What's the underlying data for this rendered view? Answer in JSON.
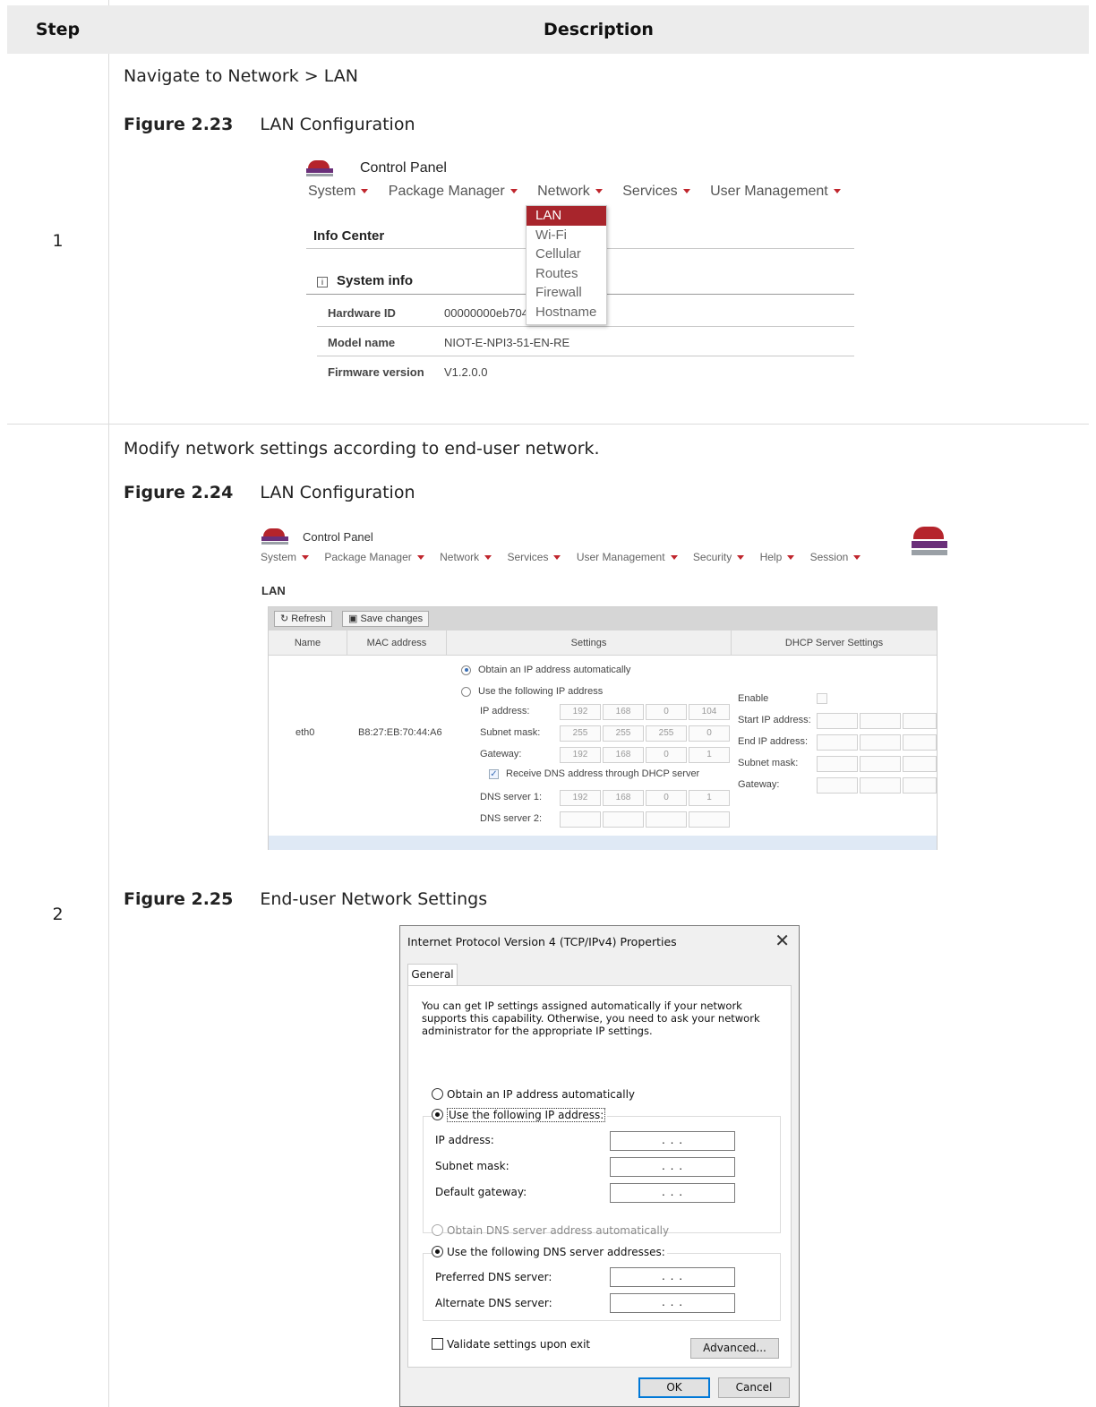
{
  "table": {
    "header_step": "Step",
    "header_description": "Description"
  },
  "step1": {
    "number": "1",
    "text": "Navigate to Network > LAN",
    "figure_number": "Figure 2.23",
    "figure_caption": "LAN Configuration",
    "screenshot": {
      "title": "Control Panel",
      "menu": [
        "System",
        "Package Manager",
        "Network",
        "Services",
        "User Management"
      ],
      "section_title": "Info Center",
      "panel_title": "System info",
      "rows": [
        {
          "key": "Hardware ID",
          "value": "00000000eb704"
        },
        {
          "key": "Model name",
          "value": "NIOT-E-NPI3-51-EN-RE"
        },
        {
          "key": "Firmware version",
          "value": "V1.2.0.0"
        }
      ],
      "network_dropdown": [
        "LAN",
        "Wi-Fi",
        "Cellular",
        "Routes",
        "Firewall",
        "Hostname"
      ]
    }
  },
  "step2": {
    "number": "2",
    "text": "Modify network settings according to end-user network.",
    "figure_a_number": "Figure 2.24",
    "figure_a_caption": "LAN Configuration",
    "figure_b_number": "Figure 2.25",
    "figure_b_caption": "End-user Network Settings",
    "lan_screenshot": {
      "title": "Control Panel",
      "menu": [
        "System",
        "Package Manager",
        "Network",
        "Services",
        "User Management",
        "Security",
        "Help",
        "Session"
      ],
      "page_title": "LAN",
      "toolbar": {
        "refresh": "Refresh",
        "save": "Save changes"
      },
      "columns": [
        "Name",
        "MAC address",
        "Settings",
        "DHCP Server Settings"
      ],
      "row": {
        "name": "eth0",
        "mac": "B8:27:EB:70:44:A6",
        "opt_auto": "Obtain an IP address automatically",
        "opt_manual": "Use the following IP address",
        "ip_label": "IP address:",
        "ip": [
          "192",
          "168",
          "0",
          "104"
        ],
        "mask_label": "Subnet mask:",
        "mask": [
          "255",
          "255",
          "255",
          "0"
        ],
        "gw_label": "Gateway:",
        "gw": [
          "192",
          "168",
          "0",
          "1"
        ],
        "dns_check": "Receive DNS address through DHCP server",
        "dns1_label": "DNS server 1:",
        "dns1": [
          "192",
          "168",
          "0",
          "1"
        ],
        "dns2_label": "DNS server 2:",
        "dhcp_enable": "Enable",
        "dhcp_start": "Start IP address:",
        "dhcp_end": "End IP address:",
        "dhcp_mask": "Subnet mask:",
        "dhcp_gw": "Gateway:"
      }
    },
    "dialog": {
      "title": "Internet Protocol Version 4 (TCP/IPv4) Properties",
      "tab": "General",
      "intro": "You can get IP settings assigned automatically if your network supports this capability. Otherwise, you need to ask your network administrator for the appropriate IP settings.",
      "opt_auto_ip": "Obtain an IP address automatically",
      "opt_manual_ip": "Use the following IP address:",
      "ip_label": "IP address:",
      "mask_label": "Subnet mask:",
      "gw_label": "Default gateway:",
      "opt_auto_dns": "Obtain DNS server address automatically",
      "opt_manual_dns": "Use the following DNS server addresses:",
      "pref_dns_label": "Preferred DNS server:",
      "alt_dns_label": "Alternate DNS server:",
      "empty_ip": ". . .",
      "validate": "Validate settings upon exit",
      "advanced": "Advanced...",
      "ok": "OK",
      "cancel": "Cancel"
    }
  }
}
